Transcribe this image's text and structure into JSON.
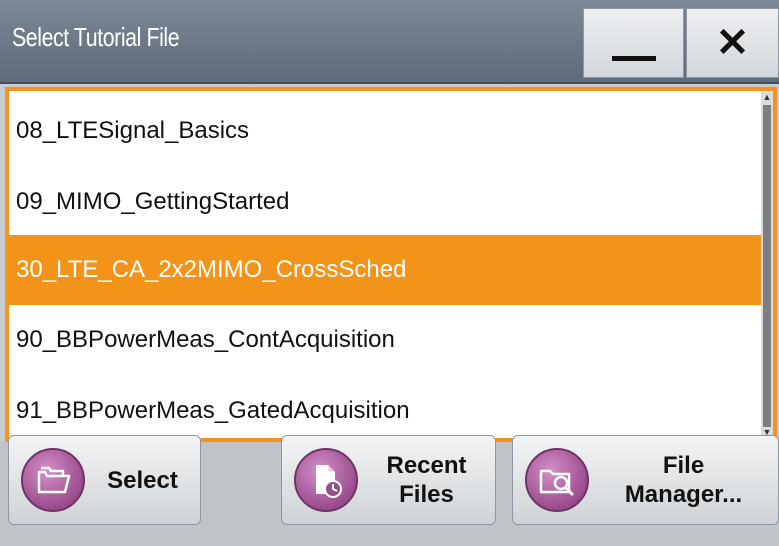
{
  "window": {
    "title": "Select Tutorial File",
    "minimize_glyph": "—",
    "close_glyph": "✕"
  },
  "files": [
    {
      "name": "08_LTESignal_Basics",
      "selected": false
    },
    {
      "name": "09_MIMO_GettingStarted",
      "selected": false
    },
    {
      "name": "30_LTE_CA_2x2MIMO_CrossSched",
      "selected": true
    },
    {
      "name": "90_BBPowerMeas_ContAcquisition",
      "selected": false
    },
    {
      "name": "91_BBPowerMeas_GatedAcquisition",
      "selected": false
    }
  ],
  "buttons": {
    "select": {
      "line1": "Select",
      "icon": "open-folder-icon"
    },
    "recent": {
      "line1": "Recent",
      "line2": "Files",
      "icon": "recent-document-clock-icon"
    },
    "file_manager": {
      "line1": "File",
      "line2": "Manager...",
      "icon": "folder-magnifier-icon"
    }
  },
  "colors": {
    "accent": "#f2931a",
    "titlebar": "#6f7b89",
    "icon_purple": "#9a4d8d"
  }
}
